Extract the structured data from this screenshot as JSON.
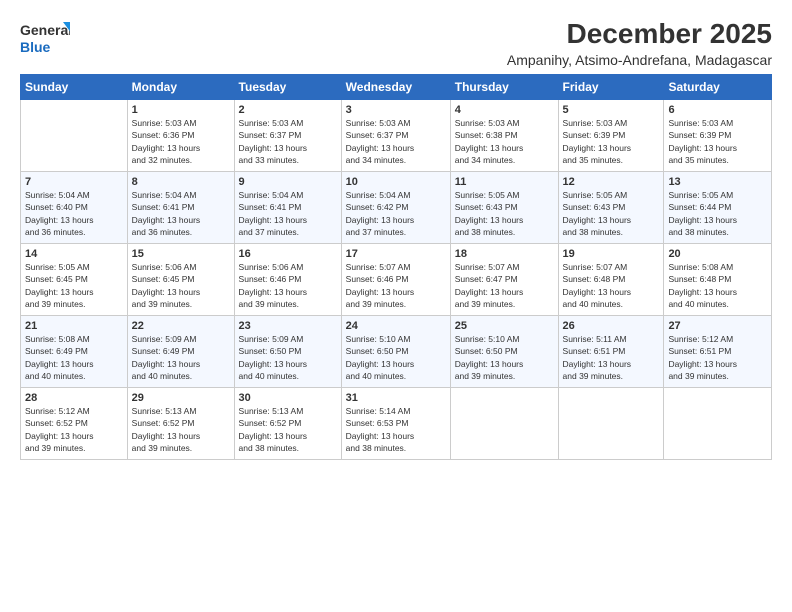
{
  "logo": {
    "line1": "General",
    "line2": "Blue"
  },
  "title": "December 2025",
  "subtitle": "Ampanihy, Atsimo-Andrefana, Madagascar",
  "weekdays": [
    "Sunday",
    "Monday",
    "Tuesday",
    "Wednesday",
    "Thursday",
    "Friday",
    "Saturday"
  ],
  "weeks": [
    [
      {
        "day": "",
        "info": ""
      },
      {
        "day": "1",
        "info": "Sunrise: 5:03 AM\nSunset: 6:36 PM\nDaylight: 13 hours\nand 32 minutes."
      },
      {
        "day": "2",
        "info": "Sunrise: 5:03 AM\nSunset: 6:37 PM\nDaylight: 13 hours\nand 33 minutes."
      },
      {
        "day": "3",
        "info": "Sunrise: 5:03 AM\nSunset: 6:37 PM\nDaylight: 13 hours\nand 34 minutes."
      },
      {
        "day": "4",
        "info": "Sunrise: 5:03 AM\nSunset: 6:38 PM\nDaylight: 13 hours\nand 34 minutes."
      },
      {
        "day": "5",
        "info": "Sunrise: 5:03 AM\nSunset: 6:39 PM\nDaylight: 13 hours\nand 35 minutes."
      },
      {
        "day": "6",
        "info": "Sunrise: 5:03 AM\nSunset: 6:39 PM\nDaylight: 13 hours\nand 35 minutes."
      }
    ],
    [
      {
        "day": "7",
        "info": "Sunrise: 5:04 AM\nSunset: 6:40 PM\nDaylight: 13 hours\nand 36 minutes."
      },
      {
        "day": "8",
        "info": "Sunrise: 5:04 AM\nSunset: 6:41 PM\nDaylight: 13 hours\nand 36 minutes."
      },
      {
        "day": "9",
        "info": "Sunrise: 5:04 AM\nSunset: 6:41 PM\nDaylight: 13 hours\nand 37 minutes."
      },
      {
        "day": "10",
        "info": "Sunrise: 5:04 AM\nSunset: 6:42 PM\nDaylight: 13 hours\nand 37 minutes."
      },
      {
        "day": "11",
        "info": "Sunrise: 5:05 AM\nSunset: 6:43 PM\nDaylight: 13 hours\nand 38 minutes."
      },
      {
        "day": "12",
        "info": "Sunrise: 5:05 AM\nSunset: 6:43 PM\nDaylight: 13 hours\nand 38 minutes."
      },
      {
        "day": "13",
        "info": "Sunrise: 5:05 AM\nSunset: 6:44 PM\nDaylight: 13 hours\nand 38 minutes."
      }
    ],
    [
      {
        "day": "14",
        "info": "Sunrise: 5:05 AM\nSunset: 6:45 PM\nDaylight: 13 hours\nand 39 minutes."
      },
      {
        "day": "15",
        "info": "Sunrise: 5:06 AM\nSunset: 6:45 PM\nDaylight: 13 hours\nand 39 minutes."
      },
      {
        "day": "16",
        "info": "Sunrise: 5:06 AM\nSunset: 6:46 PM\nDaylight: 13 hours\nand 39 minutes."
      },
      {
        "day": "17",
        "info": "Sunrise: 5:07 AM\nSunset: 6:46 PM\nDaylight: 13 hours\nand 39 minutes."
      },
      {
        "day": "18",
        "info": "Sunrise: 5:07 AM\nSunset: 6:47 PM\nDaylight: 13 hours\nand 39 minutes."
      },
      {
        "day": "19",
        "info": "Sunrise: 5:07 AM\nSunset: 6:48 PM\nDaylight: 13 hours\nand 40 minutes."
      },
      {
        "day": "20",
        "info": "Sunrise: 5:08 AM\nSunset: 6:48 PM\nDaylight: 13 hours\nand 40 minutes."
      }
    ],
    [
      {
        "day": "21",
        "info": "Sunrise: 5:08 AM\nSunset: 6:49 PM\nDaylight: 13 hours\nand 40 minutes."
      },
      {
        "day": "22",
        "info": "Sunrise: 5:09 AM\nSunset: 6:49 PM\nDaylight: 13 hours\nand 40 minutes."
      },
      {
        "day": "23",
        "info": "Sunrise: 5:09 AM\nSunset: 6:50 PM\nDaylight: 13 hours\nand 40 minutes."
      },
      {
        "day": "24",
        "info": "Sunrise: 5:10 AM\nSunset: 6:50 PM\nDaylight: 13 hours\nand 40 minutes."
      },
      {
        "day": "25",
        "info": "Sunrise: 5:10 AM\nSunset: 6:50 PM\nDaylight: 13 hours\nand 39 minutes."
      },
      {
        "day": "26",
        "info": "Sunrise: 5:11 AM\nSunset: 6:51 PM\nDaylight: 13 hours\nand 39 minutes."
      },
      {
        "day": "27",
        "info": "Sunrise: 5:12 AM\nSunset: 6:51 PM\nDaylight: 13 hours\nand 39 minutes."
      }
    ],
    [
      {
        "day": "28",
        "info": "Sunrise: 5:12 AM\nSunset: 6:52 PM\nDaylight: 13 hours\nand 39 minutes."
      },
      {
        "day": "29",
        "info": "Sunrise: 5:13 AM\nSunset: 6:52 PM\nDaylight: 13 hours\nand 39 minutes."
      },
      {
        "day": "30",
        "info": "Sunrise: 5:13 AM\nSunset: 6:52 PM\nDaylight: 13 hours\nand 38 minutes."
      },
      {
        "day": "31",
        "info": "Sunrise: 5:14 AM\nSunset: 6:53 PM\nDaylight: 13 hours\nand 38 minutes."
      },
      {
        "day": "",
        "info": ""
      },
      {
        "day": "",
        "info": ""
      },
      {
        "day": "",
        "info": ""
      }
    ]
  ]
}
